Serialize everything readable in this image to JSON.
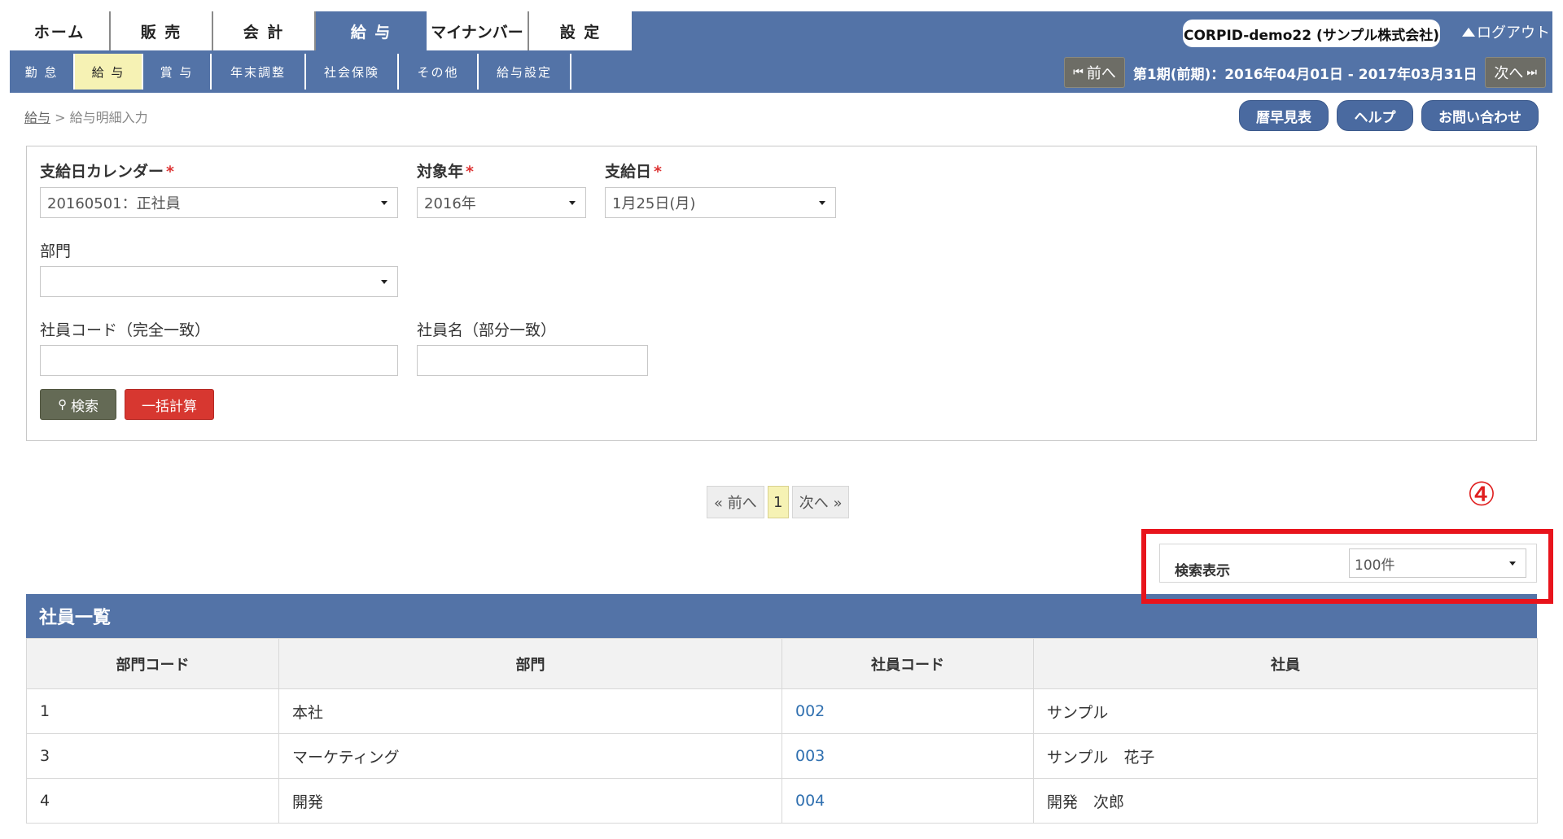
{
  "header": {
    "main_tabs": [
      "ホーム",
      "販 売",
      "会 計",
      "給 与",
      "マイナンバー",
      "設 定"
    ],
    "sub_tabs": [
      "勤 怠",
      "給 与",
      "賞 与",
      "年末調整",
      "社会保険",
      "その他",
      "給与設定"
    ],
    "company": "CORPID-demo22 (サンプル株式会社)",
    "logout": "ログアウト",
    "prev_label": "前へ",
    "next_label": "次へ",
    "period": "第1期(前期)：2016年04月01日 - 2017年03月31日"
  },
  "breadcrumb": {
    "root": "給与",
    "separator": ">",
    "current": "給与明細入力"
  },
  "top_buttons": {
    "calendar": "暦早見表",
    "help": "ヘルプ",
    "contact": "お問い合わせ"
  },
  "search": {
    "calendar_label": "支給日カレンダー",
    "calendar_value": "20160501：正社員",
    "year_label": "対象年",
    "year_value": "2016年",
    "payday_label": "支給日",
    "payday_value": "1月25日(月)",
    "dept_label": "部門",
    "dept_value": "",
    "emp_code_label": "社員コード（完全一致）",
    "emp_code_value": "",
    "emp_name_label": "社員名（部分一致）",
    "emp_name_value": "",
    "required_mark": "*",
    "search_button": "検索",
    "bulk_calc_button": "一括計算"
  },
  "pagination": {
    "prev": "« 前へ",
    "current": "1",
    "next": "次へ »"
  },
  "display": {
    "annotation": "④",
    "label": "検索表示",
    "value": "100件"
  },
  "employees": {
    "title": "社員一覧",
    "columns": [
      "部門コード",
      "部門",
      "社員コード",
      "社員"
    ],
    "rows": [
      {
        "dept_code": "1",
        "dept": "本社",
        "emp_code": "002",
        "name": "サンプル"
      },
      {
        "dept_code": "3",
        "dept": "マーケティング",
        "emp_code": "003",
        "name": "サンプル　花子"
      },
      {
        "dept_code": "4",
        "dept": "開発",
        "emp_code": "004",
        "name": "開発　次郎"
      }
    ]
  },
  "colors": {
    "header_blue": "#5373a7",
    "active_subtab": "#f6f2b4",
    "danger": "#d73730",
    "annotation_red": "#e8141c"
  }
}
